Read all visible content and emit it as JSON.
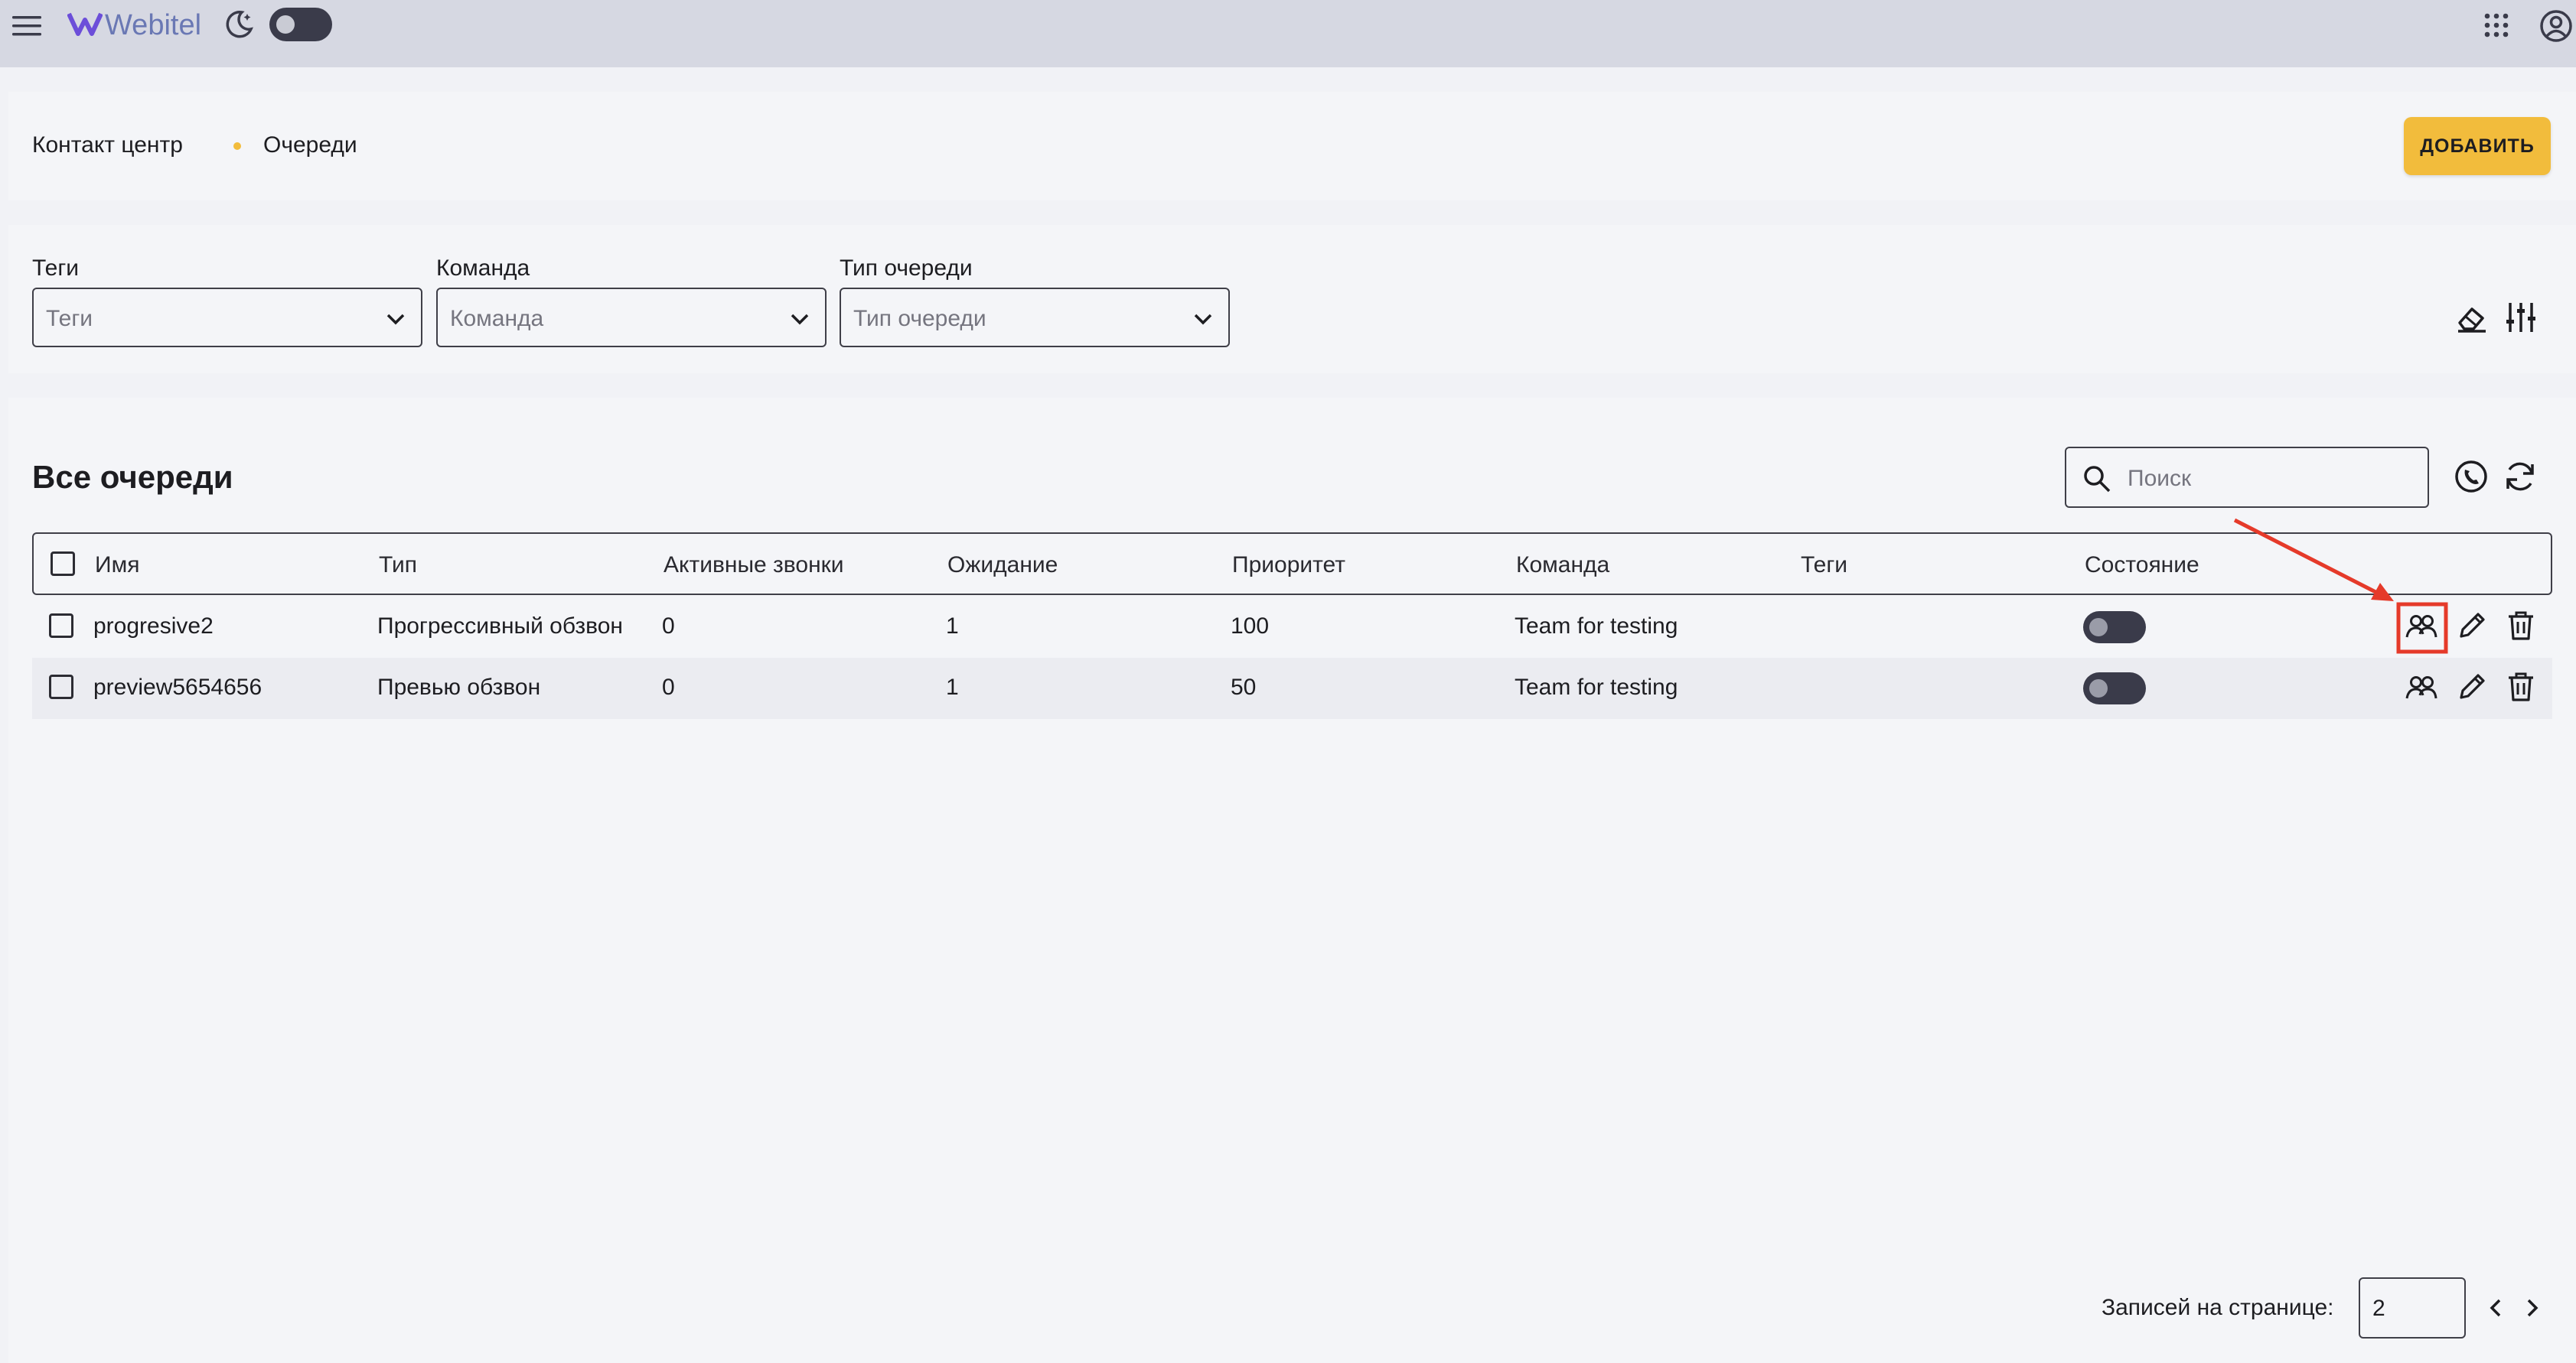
{
  "header": {
    "brand": "Webitel",
    "icons": [
      "menu-icon",
      "moon-icon",
      "theme-toggle",
      "apps-grid-icon",
      "account-icon"
    ]
  },
  "breadcrumb": {
    "parent": "Контакт центр",
    "current": "Очереди",
    "separator_color": "#f2bc3c"
  },
  "actions": {
    "add_label": "ДОБАВИТЬ",
    "accent_color": "#f2bc3c"
  },
  "filters": [
    {
      "label": "Теги",
      "placeholder": "Теги"
    },
    {
      "label": "Команда",
      "placeholder": "Команда"
    },
    {
      "label": "Тип очереди",
      "placeholder": "Тип очереди"
    }
  ],
  "table": {
    "title": "Все очереди",
    "search_placeholder": "Поиск",
    "columns": [
      "Имя",
      "Тип",
      "Активные звонки",
      "Ожидание",
      "Приоритет",
      "Команда",
      "Теги",
      "Состояние"
    ],
    "rows": [
      {
        "name": "progresive2",
        "type": "Прогрессивный обзвон",
        "active_calls": "0",
        "waiting": "1",
        "priority": "100",
        "team": "Team for testing",
        "tags": "",
        "enabled": false
      },
      {
        "name": "preview5654656",
        "type": "Превью обзвон",
        "active_calls": "0",
        "waiting": "1",
        "priority": "50",
        "team": "Team for testing",
        "tags": "",
        "enabled": false
      }
    ],
    "row_actions": [
      "members-icon",
      "edit-icon",
      "delete-icon"
    ]
  },
  "pagination": {
    "label": "Записей на странице:",
    "per_page": "2"
  },
  "annotation": {
    "color": "#e53a2a"
  }
}
